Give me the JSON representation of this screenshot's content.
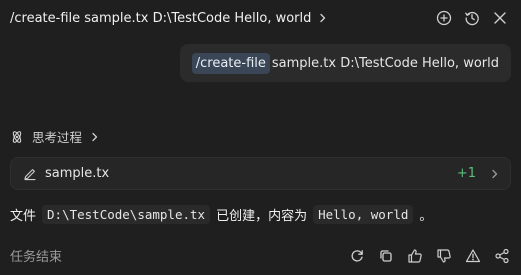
{
  "header": {
    "title": "/create-file sample.tx D:\\TestCode Hello, world",
    "icons": [
      "chevron-right-icon",
      "add-circle-icon",
      "history-icon",
      "close-icon"
    ]
  },
  "prompt": {
    "command": "/create-file",
    "rest": "sample.tx D:\\TestCode Hello, world"
  },
  "thinking": {
    "label": "思考过程",
    "icon": "thinking-icon"
  },
  "file_card": {
    "filename": "sample.tx",
    "added": "+1",
    "icons": [
      "edit-icon",
      "chevron-right-icon"
    ]
  },
  "result": {
    "part1": "文件",
    "path": "D:\\TestCode\\sample.tx",
    "part2": "已创建，内容为",
    "content": "Hello, world",
    "part3": "。"
  },
  "footer": {
    "status": "任务结束",
    "icons": [
      "refresh-icon",
      "copy-icon",
      "thumbs-up-icon",
      "thumbs-down-icon",
      "warning-icon",
      "share-icon"
    ]
  },
  "colors": {
    "background": "#1f1f1f",
    "command_chip": "#3a4656",
    "added": "#5cbf7b"
  }
}
